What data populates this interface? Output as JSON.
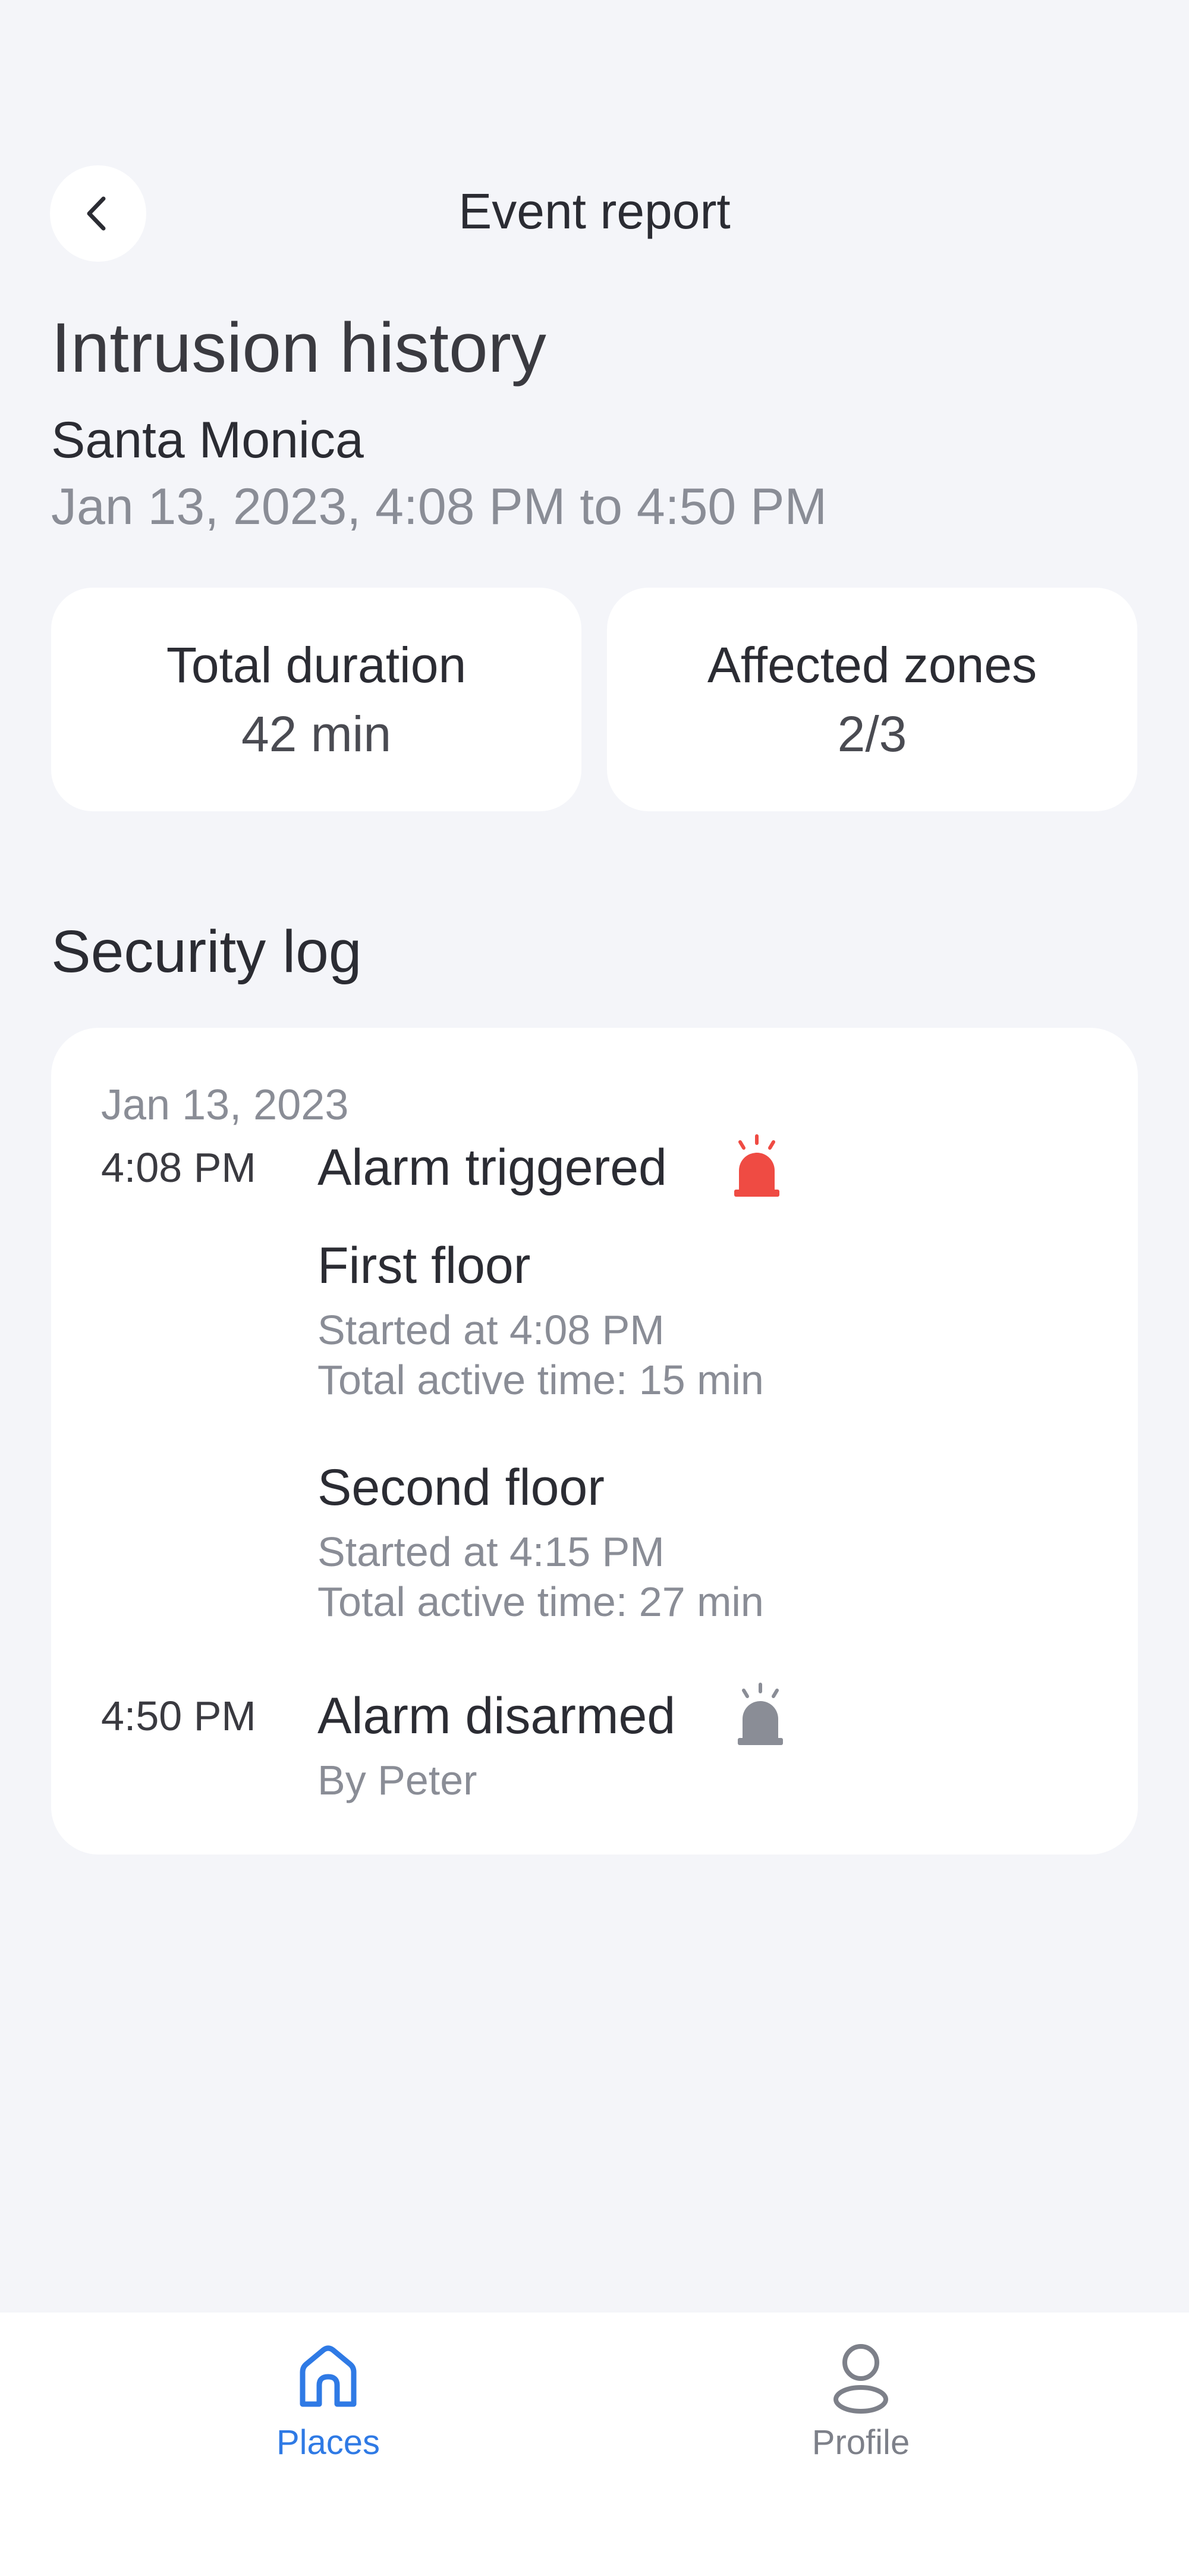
{
  "header": {
    "title": "Event report",
    "back_icon": "chevron-left-icon"
  },
  "page": {
    "title": "Intrusion history",
    "place": "Santa Monica",
    "date_range": "Jan 13, 2023, 4:08 PM to 4:50 PM"
  },
  "stats": [
    {
      "label": "Total duration",
      "value": "42 min"
    },
    {
      "label": "Affected zones",
      "value": "2/3"
    }
  ],
  "security_log": {
    "title": "Security log",
    "date": "Jan 13, 2023",
    "events": [
      {
        "time": "4:08 PM",
        "title": "Alarm triggered",
        "icon": "siren-icon",
        "icon_color": "#ef4b43",
        "zones": [
          {
            "name": "First floor",
            "started": "Started at 4:08 PM",
            "active": "Total active time: 15 min"
          },
          {
            "name": "Second floor",
            "started": "Started at 4:15 PM",
            "active": "Total active time: 27 min"
          }
        ]
      },
      {
        "time": "4:50 PM",
        "title": "Alarm disarmed",
        "icon": "siren-icon",
        "icon_color": "#8a8d96",
        "subtitle": "By Peter"
      }
    ]
  },
  "bottom_nav": {
    "items": [
      {
        "label": "Places",
        "icon": "home-icon",
        "active": true
      },
      {
        "label": "Profile",
        "icon": "user-icon",
        "active": false
      }
    ],
    "active_color": "#2f7ae5",
    "inactive_color": "#7d8089"
  }
}
